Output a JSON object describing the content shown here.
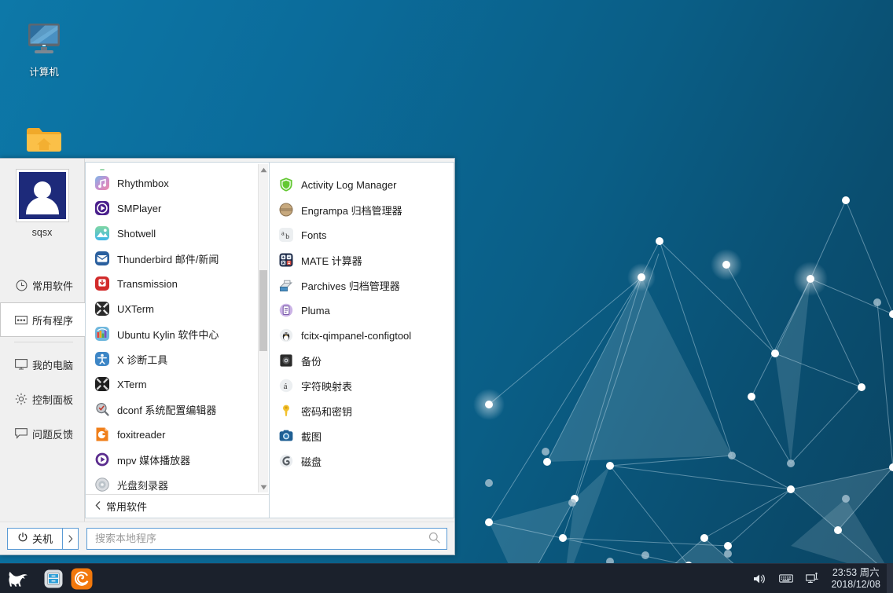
{
  "desktop": {
    "icons": [
      {
        "name": "computer",
        "label": "计算机",
        "icon": "monitor-icon"
      },
      {
        "name": "home-folder",
        "label": "",
        "icon": "home-folder-icon"
      }
    ],
    "wallpaper_colors": [
      "#0d78a8",
      "#0b6c9b",
      "#0a5e86",
      "#0a4e70",
      "#0b4462"
    ]
  },
  "start_menu": {
    "user": {
      "name": "sqsx",
      "avatar_bg": "#1d2a7a"
    },
    "rail": [
      {
        "label": "常用软件",
        "icon": "clock-icon",
        "selected": false
      },
      {
        "label": "所有程序",
        "icon": "grid-icon",
        "selected": true
      },
      {
        "label": "我的电脑",
        "icon": "monitor-icon",
        "selected": false
      },
      {
        "label": "控制面板",
        "icon": "gear-icon",
        "selected": false
      },
      {
        "label": "问题反馈",
        "icon": "feedback-icon",
        "selected": false
      }
    ],
    "app_list": [
      {
        "label": "Rhythmbox",
        "icon": "rhythmbox-icon"
      },
      {
        "label": "SMPlayer",
        "icon": "smplayer-icon"
      },
      {
        "label": "Shotwell",
        "icon": "shotwell-icon"
      },
      {
        "label": "Thunderbird 邮件/新闻",
        "icon": "thunderbird-icon"
      },
      {
        "label": "Transmission",
        "icon": "transmission-icon"
      },
      {
        "label": "UXTerm",
        "icon": "uxterm-icon"
      },
      {
        "label": "Ubuntu Kylin 软件中心",
        "icon": "ubuntu-kylin-software-center-icon"
      },
      {
        "label": "X 诊断工具",
        "icon": "x-diagnostic-icon"
      },
      {
        "label": "XTerm",
        "icon": "xterm-icon"
      },
      {
        "label": "dconf 系统配置编辑器",
        "icon": "dconf-icon"
      },
      {
        "label": "foxitreader",
        "icon": "foxitreader-icon"
      },
      {
        "label": "mpv 媒体播放器",
        "icon": "mpv-icon"
      },
      {
        "label": "光盘刻录器",
        "icon": "disc-burner-icon"
      }
    ],
    "back_row": {
      "label": "常用软件",
      "icon": "chevron-left-icon"
    },
    "category_list": [
      {
        "label": "Activity Log Manager",
        "icon": "shield-icon"
      },
      {
        "label": "Engrampa 归档管理器",
        "icon": "engrampa-icon"
      },
      {
        "label": "Fonts",
        "icon": "fonts-icon"
      },
      {
        "label": "MATE 计算器",
        "icon": "calculator-icon"
      },
      {
        "label": "Parchives 归档管理器",
        "icon": "parchives-icon"
      },
      {
        "label": "Pluma",
        "icon": "pluma-icon"
      },
      {
        "label": "fcitx-qimpanel-configtool",
        "icon": "fcitx-icon"
      },
      {
        "label": "备份",
        "icon": "backup-icon"
      },
      {
        "label": "字符映射表",
        "icon": "charmap-icon"
      },
      {
        "label": "密码和密钥",
        "icon": "key-icon"
      },
      {
        "label": "截图",
        "icon": "screenshot-icon"
      },
      {
        "label": "磁盘",
        "icon": "disks-icon"
      }
    ],
    "footer": {
      "shutdown_label": "关机",
      "shutdown_icon": "power-icon",
      "more_icon": "chevron-right-icon",
      "search_placeholder": "搜索本地程序",
      "search_value": "",
      "search_icon": "search-icon"
    },
    "scrollbar": {
      "up_icon": "caret-up-icon",
      "down_icon": "caret-down-icon"
    }
  },
  "taskbar": {
    "start_button": {
      "name": "kylin-start-button",
      "icon": "kylin-logo-icon"
    },
    "launchers": [
      {
        "name": "file-manager",
        "icon": "file-manager-icon"
      },
      {
        "name": "firefox",
        "icon": "firefox-icon"
      }
    ],
    "tray": [
      {
        "name": "volume",
        "icon": "volume-icon"
      },
      {
        "name": "keyboard-input",
        "icon": "keyboard-icon"
      },
      {
        "name": "network",
        "icon": "network-icon"
      }
    ],
    "clock": {
      "time": "23:53 周六",
      "date": "2018/12/08"
    }
  }
}
